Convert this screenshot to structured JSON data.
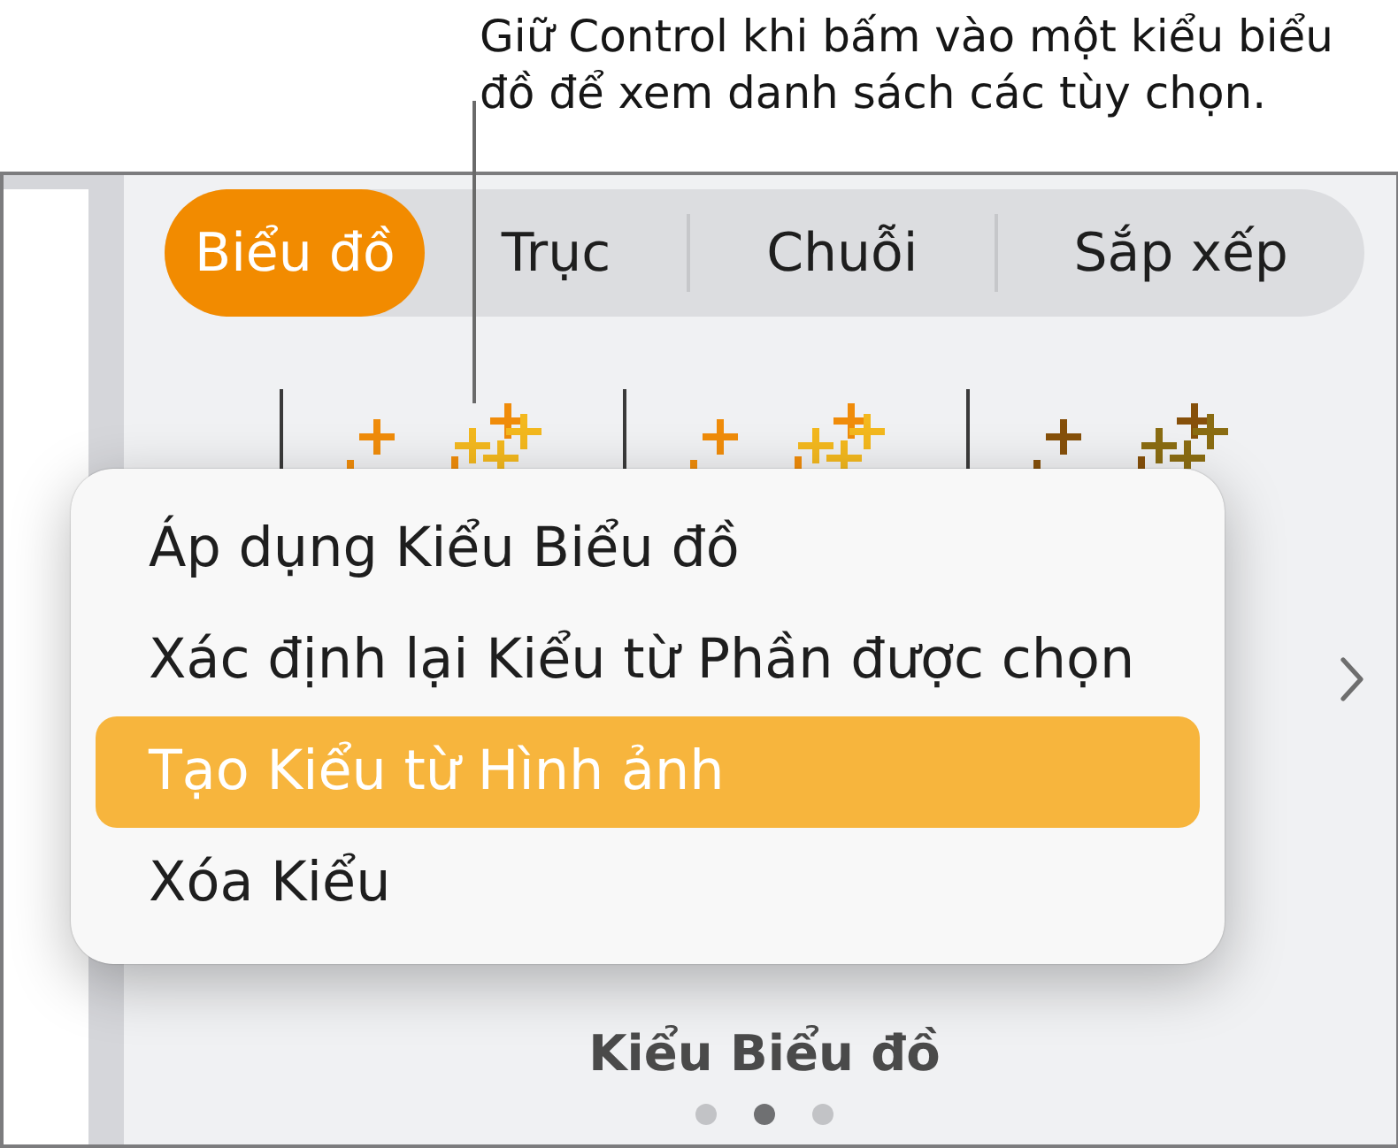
{
  "callout": {
    "text": "Giữ Control khi bấm vào một kiểu biểu đồ để xem danh sách các tùy chọn."
  },
  "tabs": [
    {
      "label": "Biểu đồ",
      "selected": true
    },
    {
      "label": "Trục",
      "selected": false
    },
    {
      "label": "Chuỗi",
      "selected": false
    },
    {
      "label": "Sắp xếp",
      "selected": false
    }
  ],
  "context_menu": {
    "items": [
      {
        "label": "Áp dụng Kiểu Biểu đồ",
        "selected": false
      },
      {
        "label": "Xác định lại Kiểu từ Phần được chọn",
        "selected": false
      },
      {
        "label": "Tạo Kiểu từ Hình ảnh",
        "selected": true
      },
      {
        "label": "Xóa Kiểu",
        "selected": false
      }
    ]
  },
  "section_title": "Kiểu Biểu đồ",
  "page_dots": [
    {
      "selected": false
    },
    {
      "selected": true
    },
    {
      "selected": false
    }
  ]
}
